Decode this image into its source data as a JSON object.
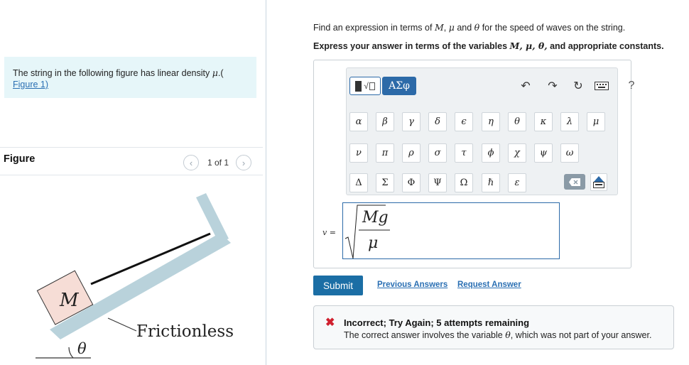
{
  "intro": {
    "text": "The string in the following figure has linear density",
    "symbol": "μ",
    "paren": ".(",
    "figure_link": "Figure 1)"
  },
  "figure": {
    "title": "Figure",
    "count": "1 of 1",
    "prev_icon": "chevron-left-icon",
    "next_icon": "chevron-right-icon",
    "mass_label": "M",
    "angle_label": "θ",
    "surface_label": "Frictionless"
  },
  "question": {
    "prefix": "Find an expression in terms of",
    "var1": "M",
    "sep1": ",",
    "var2": "μ",
    "and": "and",
    "var3": "θ",
    "suffix": "for the speed of waves on the string."
  },
  "instruction": {
    "prefix": "Express your answer in terms of the variables",
    "vars": "M, μ, θ,",
    "suffix": "and appropriate constants."
  },
  "toolbar": {
    "templates_icon": "templates-icon",
    "greek_label": "ΑΣφ",
    "undo_icon": "undo-icon",
    "redo_icon": "redo-icon",
    "reset_icon": "reset-icon",
    "keyboard_icon": "keyboard-icon",
    "help_label": "?",
    "row1": [
      "α",
      "β",
      "γ",
      "δ",
      "ϵ",
      "η",
      "θ",
      "κ",
      "λ",
      "μ"
    ],
    "row2": [
      "ν",
      "π",
      "ρ",
      "σ",
      "τ",
      "ϕ",
      "χ",
      "ψ",
      "ω"
    ],
    "row3": [
      "Δ",
      "Σ",
      "Φ",
      "Ψ",
      "Ω",
      "ℏ",
      "ε"
    ],
    "delete_icon": "delete-icon",
    "toggle_keyboard_icon": "keyboard-toggle-icon"
  },
  "answer": {
    "label": "v =",
    "numerator": "Mg",
    "denominator": "μ"
  },
  "actions": {
    "submit": "Submit",
    "previous": "Previous Answers",
    "request": "Request Answer"
  },
  "feedback": {
    "icon": "x-icon",
    "title": "Incorrect; Try Again; 5 attempts remaining",
    "text_prefix": "The correct answer involves the variable",
    "text_var": "θ",
    "text_suffix": ", which was not part of your answer.",
    "color": "#d0202e"
  },
  "colors": {
    "accent": "#1b6ea5",
    "intro_bg": "#e6f6f9",
    "link": "#2a6fb3"
  }
}
